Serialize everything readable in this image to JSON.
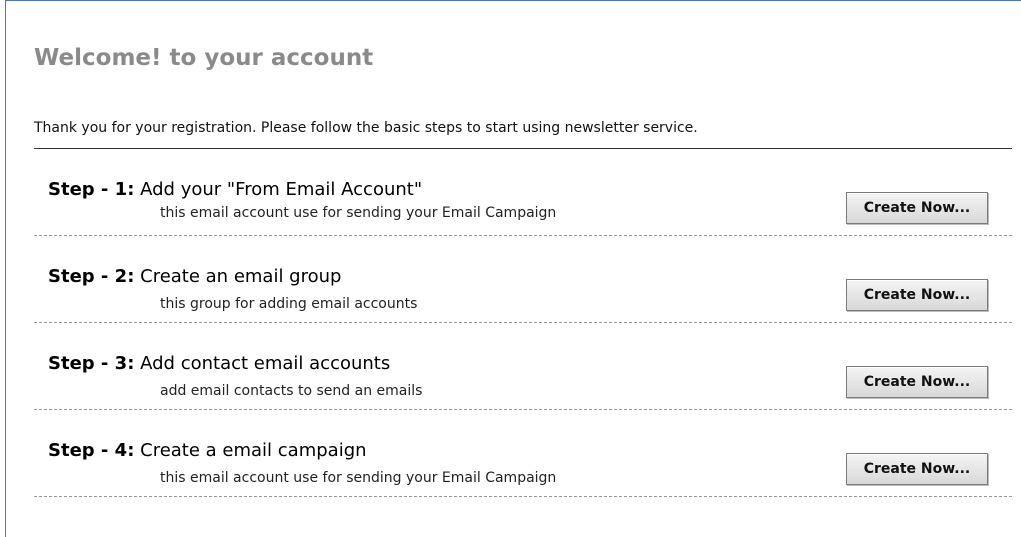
{
  "welcome": {
    "title": "Welcome! to your account",
    "intro": "Thank you for your registration. Please follow the basic steps to start using newsletter service."
  },
  "steps": [
    {
      "label": "Step - 1:",
      "title": "Add your \"From Email Account\"",
      "description": "this email account use for sending your Email Campaign",
      "button": "Create Now..."
    },
    {
      "label": "Step - 2:",
      "title": "Create an email group",
      "description": "this group for adding email accounts",
      "button": "Create Now..."
    },
    {
      "label": "Step - 3:",
      "title": "Add contact email accounts",
      "description": "add email contacts to send an emails",
      "button": "Create Now..."
    },
    {
      "label": "Step - 4:",
      "title": "Create a email campaign",
      "description": "this email account use for sending your Email Campaign",
      "button": "Create Now..."
    }
  ],
  "colors": {
    "panel_border": "#4a78b5",
    "title_gray": "#8a8a8a",
    "divider": "#333333",
    "dashed_divider": "#9a9a9a"
  }
}
